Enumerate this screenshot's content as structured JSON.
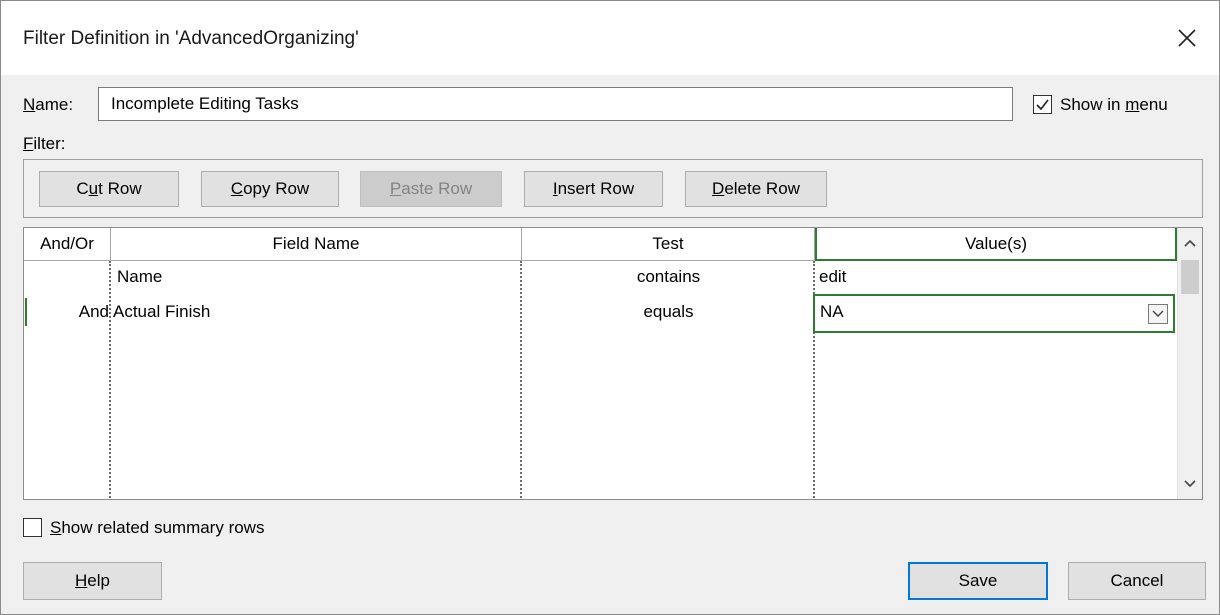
{
  "window": {
    "title": "Filter Definition in 'AdvancedOrganizing'"
  },
  "name_label": {
    "mnemonic": "N",
    "rest": "ame:"
  },
  "name_value": "Incomplete Editing Tasks",
  "show_in_menu": {
    "pre": "Show in ",
    "mnemonic": "m",
    "post": "enu",
    "checked": true
  },
  "filter_label": {
    "mnemonic": "F",
    "rest": "ilter:"
  },
  "toolbar": {
    "cut": {
      "pre": "C",
      "mnemonic": "u",
      "post": "t Row"
    },
    "copy": {
      "pre": "",
      "mnemonic": "C",
      "post": "opy Row"
    },
    "paste": {
      "pre": "",
      "mnemonic": "P",
      "post": "aste Row",
      "enabled": false
    },
    "insert": {
      "pre": "",
      "mnemonic": "I",
      "post": "nsert Row"
    },
    "delete": {
      "pre": "",
      "mnemonic": "D",
      "post": "elete Row"
    }
  },
  "table": {
    "headers": [
      "And/Or",
      "Field Name",
      "Test",
      "Value(s)"
    ],
    "rows": [
      {
        "and_or": "",
        "field": "Name",
        "test": "contains",
        "value": "edit"
      },
      {
        "and_or": "And",
        "field": "Actual Finish",
        "test": "equals",
        "value": "NA"
      }
    ]
  },
  "show_related": {
    "mnemonic": "S",
    "rest": "how related summary rows",
    "checked": false
  },
  "buttons": {
    "help": {
      "mnemonic": "H",
      "rest": "elp"
    },
    "save": "Save",
    "cancel": "Cancel"
  },
  "colors": {
    "selection": "#2e7d32",
    "dialog_bg": "#f0f0f0",
    "default_button_border": "#0078d7"
  }
}
